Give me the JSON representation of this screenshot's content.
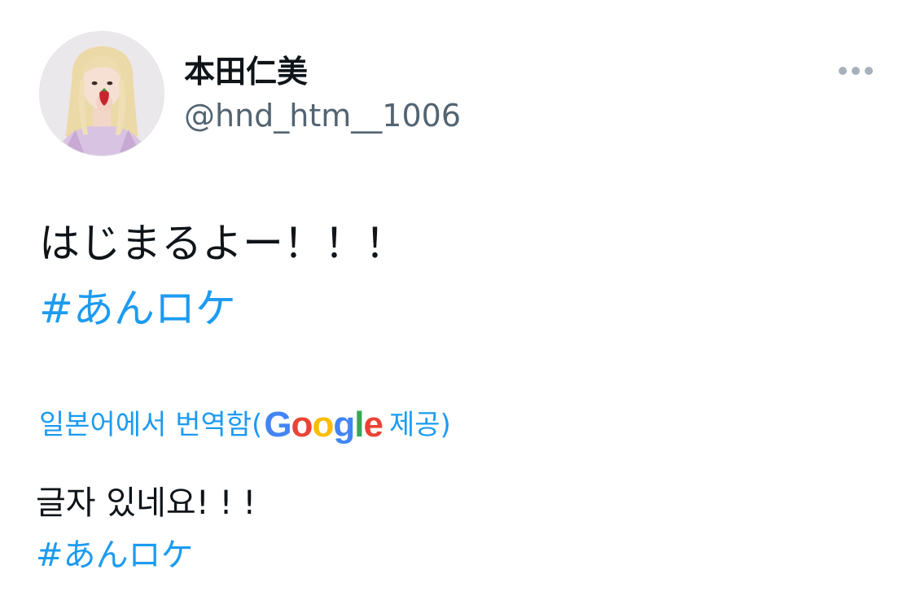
{
  "tweet": {
    "author": {
      "display_name": "本田仁美",
      "handle": "@hnd_htm__1006"
    },
    "more_icon": "more-horizontal-icon",
    "text": "はじまるよー！！！",
    "hashtag": "#あんロケ"
  },
  "translation": {
    "label_prefix": "일본어에서 번역함(",
    "provider": {
      "G": "G",
      "o1": "o",
      "o2": "o",
      "g": "g",
      "l": "l",
      "e": "e"
    },
    "label_suffix": " 제공)",
    "text": "글자 있네요! ! !",
    "hashtag": "#あんロケ"
  },
  "colors": {
    "link": "#1d9bf0",
    "text": "#0f1419",
    "secondary": "#536471",
    "google_blue": "#4285F4",
    "google_red": "#EA4335",
    "google_yellow": "#FBBC05",
    "google_green": "#34A853"
  }
}
